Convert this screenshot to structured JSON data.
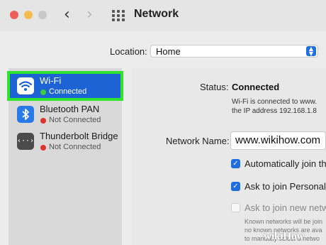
{
  "window": {
    "title": "Network",
    "back_icon": "chevron-left-icon",
    "forward_icon": "chevron-right-icon",
    "grid_icon": "grid-icon"
  },
  "location": {
    "label": "Location:",
    "value": "Home"
  },
  "sidebar": {
    "items": [
      {
        "name": "Wi-Fi",
        "status": "Connected",
        "status_color": "#3ccb3c",
        "icon": "wifi-icon",
        "selected": true
      },
      {
        "name": "Bluetooth PAN",
        "status": "Not Connected",
        "status_color": "#e0332c",
        "icon": "bluetooth-icon"
      },
      {
        "name": "Thunderbolt Bridge",
        "status": "Not Connected",
        "status_color": "#e0332c",
        "icon": "thunderbolt-icon"
      }
    ],
    "highlight_color": "#2fe32f",
    "selected_color": "#1d63d6"
  },
  "detail": {
    "status_label": "Status:",
    "status_value": "Connected",
    "status_desc_line1": "Wi-Fi is connected to www.",
    "status_desc_line2": "the IP address 192.168.1.8",
    "network_name_label": "Network Name:",
    "network_name_value": "www.wikihow.com",
    "options": [
      {
        "label": "Automatically join thi",
        "checked": true
      },
      {
        "label": "Ask to join Personal H",
        "checked": true
      },
      {
        "label": "Ask to join new netwo",
        "checked": false
      }
    ],
    "known_line1": "Known networks will be join",
    "known_line2": "no known networks are ava",
    "known_line3": "to manually select a netwo"
  },
  "watermark": "wikiHow"
}
